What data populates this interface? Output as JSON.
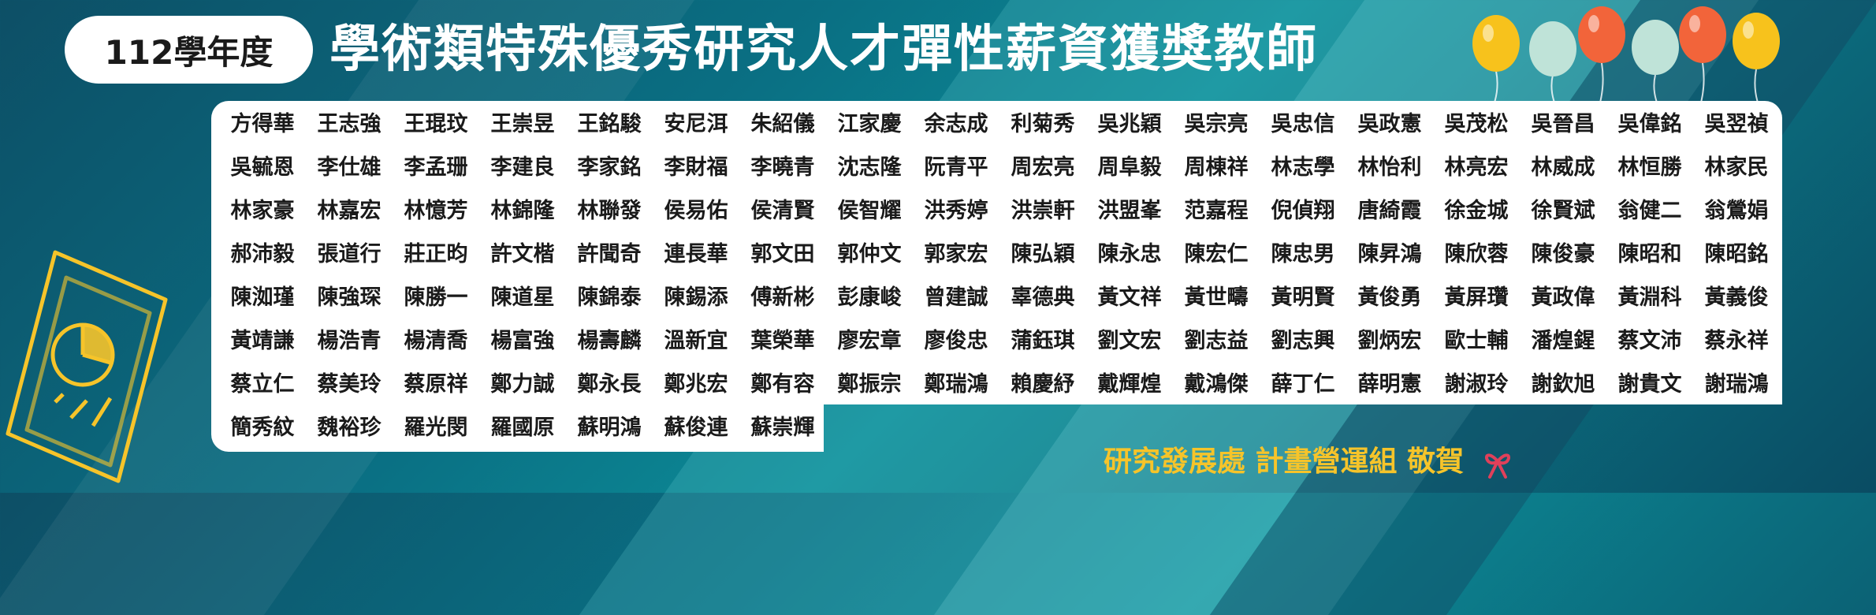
{
  "header": {
    "year": "112學年度",
    "title": "學術類特殊優秀研究人才彈性薪資獲獎教師"
  },
  "names": [
    "方得華",
    "王志強",
    "王琨玟",
    "王崇昱",
    "王銘駿",
    "安尼洱",
    "朱紹儀",
    "江家慶",
    "余志成",
    "利菊秀",
    "吳兆穎",
    "吳宗亮",
    "吳忠信",
    "吳政憲",
    "吳茂松",
    "吳晉昌",
    "吳偉銘",
    "吳翌禎",
    "吳毓恩",
    "李仕雄",
    "李孟珊",
    "李建良",
    "李家銘",
    "李財福",
    "李曉青",
    "沈志隆",
    "阮青平",
    "周宏亮",
    "周阜毅",
    "周棟祥",
    "林志學",
    "林怡利",
    "林亮宏",
    "林威成",
    "林恒勝",
    "林家民",
    "林家豪",
    "林嘉宏",
    "林憶芳",
    "林錦隆",
    "林聯發",
    "侯易佑",
    "侯清賢",
    "侯智耀",
    "洪秀婷",
    "洪崇軒",
    "洪盟峯",
    "范嘉程",
    "倪偵翔",
    "唐綺霞",
    "徐金城",
    "徐賢斌",
    "翁健二",
    "翁鶯娟",
    "郝沛毅",
    "張道行",
    "莊正昀",
    "許文楷",
    "許聞奇",
    "連長華",
    "郭文田",
    "郭仲文",
    "郭家宏",
    "陳弘穎",
    "陳永忠",
    "陳宏仁",
    "陳忠男",
    "陳昇鴻",
    "陳欣蓉",
    "陳俊豪",
    "陳昭和",
    "陳昭銘",
    "陳洳瑾",
    "陳強琛",
    "陳勝一",
    "陳道星",
    "陳錦泰",
    "陳錫添",
    "傅新彬",
    "彭康峻",
    "曾建誠",
    "辜德典",
    "黃文祥",
    "黃世疇",
    "黃明賢",
    "黃俊勇",
    "黃屏瓚",
    "黃政偉",
    "黃淵科",
    "黃義俊",
    "黃靖謙",
    "楊浩青",
    "楊清喬",
    "楊富強",
    "楊壽麟",
    "溫新宜",
    "葉榮華",
    "廖宏章",
    "廖俊忠",
    "蒲鈺琪",
    "劉文宏",
    "劉志益",
    "劉志興",
    "劉炳宏",
    "歐士輔",
    "潘煌鍟",
    "蔡文沛",
    "蔡永祥",
    "蔡立仁",
    "蔡美玲",
    "蔡原祥",
    "鄭力誠",
    "鄭永長",
    "鄭兆宏",
    "鄭有容",
    "鄭振宗",
    "鄭瑞鴻",
    "賴慶紓",
    "戴輝煌",
    "戴鴻傑",
    "薛丁仁",
    "薛明憲",
    "謝淑玲",
    "謝欽旭",
    "謝貴文",
    "謝瑞鴻",
    "簡秀紋",
    "魏裕珍",
    "羅光閔",
    "羅國原",
    "蘇明鴻",
    "蘇俊連",
    "蘇崇輝"
  ],
  "footer": {
    "credit": "研究發展處 計畫營運組 敬賀"
  },
  "icons": {
    "balloons": "balloon-icon",
    "ribbon": "ribbon-icon",
    "document": "document-chart-icon"
  },
  "colors": {
    "accent_yellow": "#f6c42a",
    "balloon_yellow": "#f7c21c",
    "balloon_mint": "#bfe3d8",
    "balloon_orange": "#f2643a"
  }
}
